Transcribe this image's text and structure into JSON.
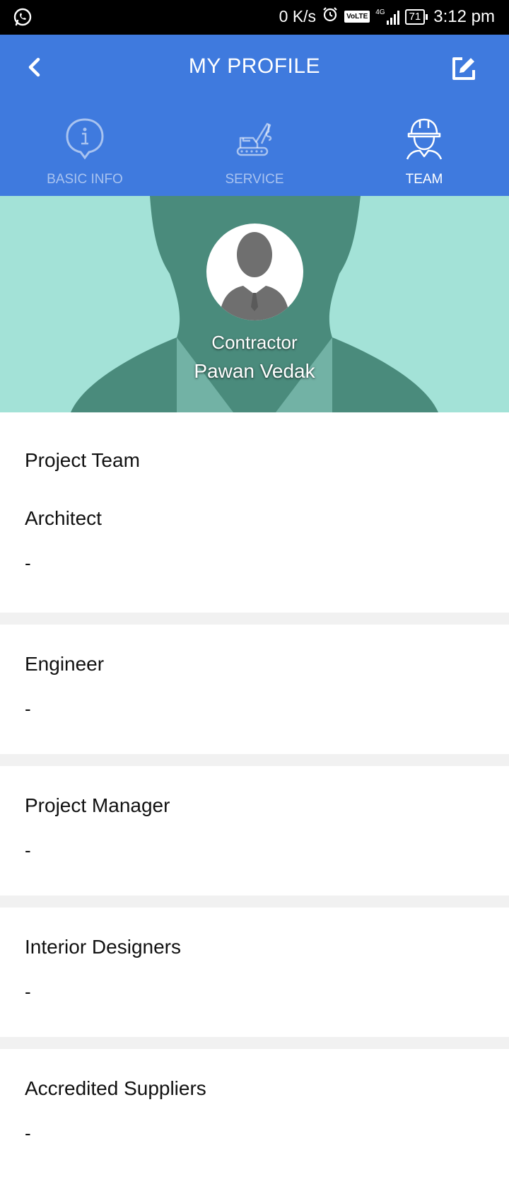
{
  "status_bar": {
    "net_speed": "0 K/s",
    "volte": "VoLTE",
    "network": "4G",
    "battery": "71",
    "time": "3:12 pm"
  },
  "header": {
    "title": "MY PROFILE"
  },
  "tabs": [
    {
      "label": "BASIC INFO",
      "icon": "info-icon",
      "active": false
    },
    {
      "label": "SERVICE",
      "icon": "crane-icon",
      "active": false
    },
    {
      "label": "TEAM",
      "icon": "worker-helmet-icon",
      "active": true
    }
  ],
  "profile": {
    "role": "Contractor",
    "name": "Pawan Vedak"
  },
  "team": {
    "heading": "Project Team",
    "groups": [
      {
        "title": "Architect",
        "value": "-"
      },
      {
        "title": "Engineer",
        "value": "-"
      },
      {
        "title": "Project Manager",
        "value": "-"
      },
      {
        "title": "Interior Designers",
        "value": "-"
      },
      {
        "title": "Accredited Suppliers",
        "value": "-"
      }
    ]
  },
  "colors": {
    "app_bar": "#3f7ade",
    "hero_bg": "#a3e2d7",
    "hero_silhouette": "#4a8b7c",
    "divider": "#f1f1f1"
  }
}
